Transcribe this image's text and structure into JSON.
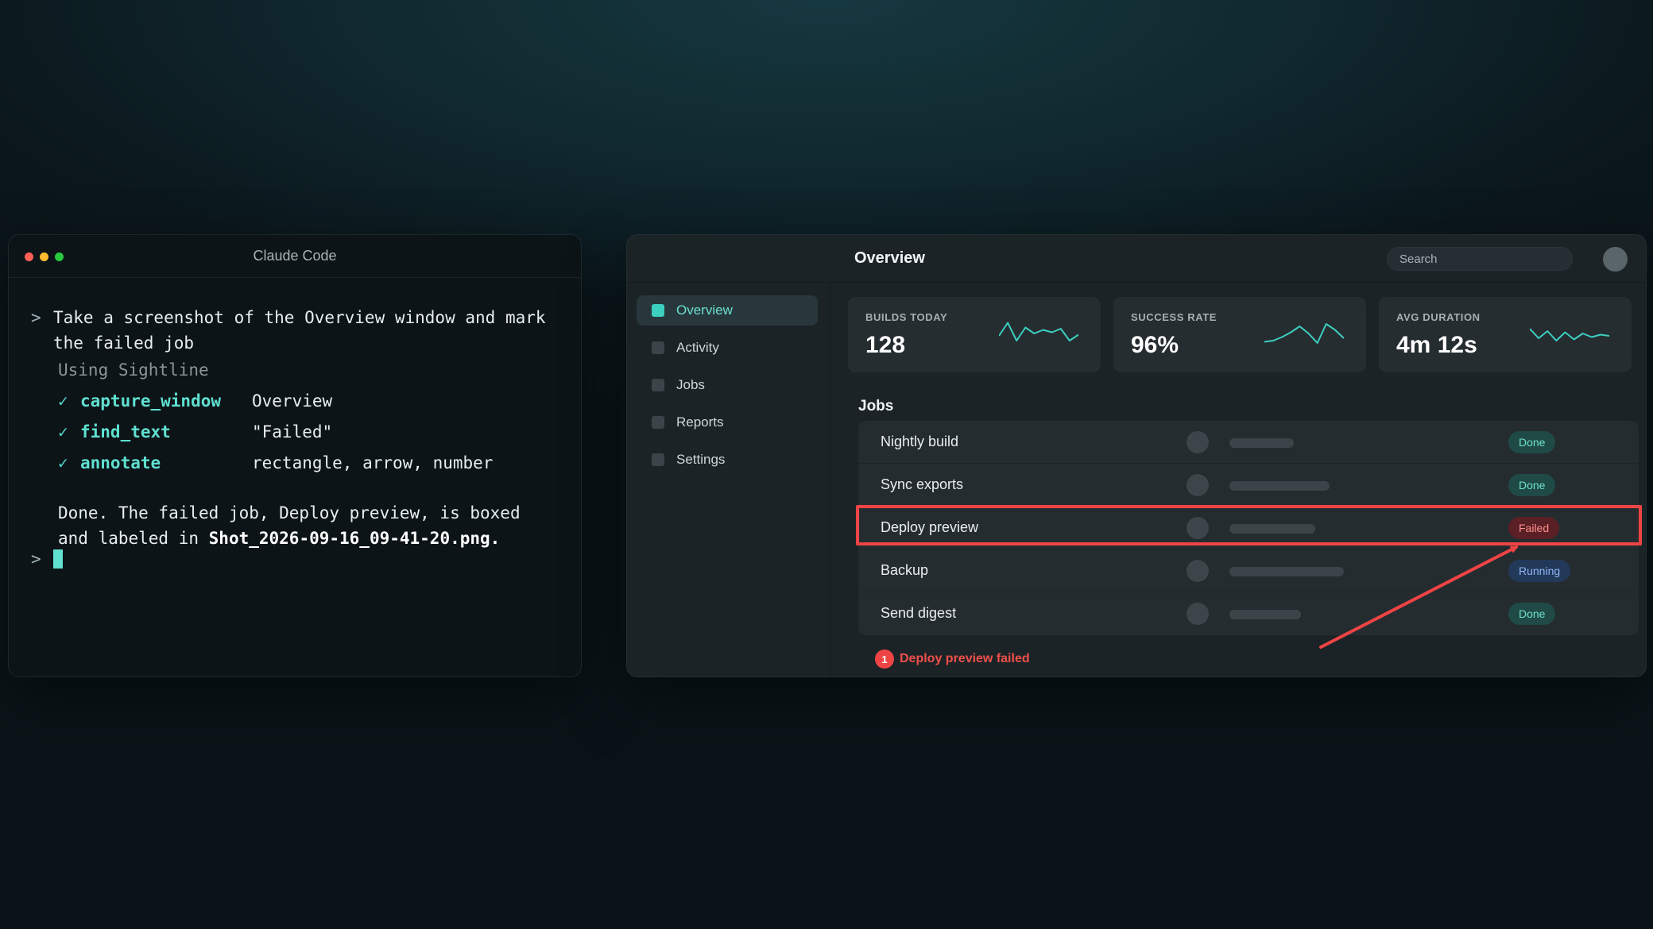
{
  "terminal": {
    "title": "Claude Code",
    "prompt_char": ">",
    "prompt_line1": "Take a screenshot of the Overview window and mark",
    "prompt_line2": "the failed job",
    "using": "Using Sightline",
    "check_glyph": "✓",
    "tools": [
      {
        "name": "capture_window",
        "arg": "Overview"
      },
      {
        "name": "find_text",
        "arg": "\"Failed\""
      },
      {
        "name": "annotate",
        "arg": "rectangle, arrow, number"
      }
    ],
    "result_line1": "Done. The failed job, Deploy preview, is boxed",
    "result_line2_prefix": "and labeled in ",
    "result_file": "Shot_2026-09-16_09-41-20.png",
    "result_suffix": "."
  },
  "app": {
    "title": "Overview",
    "search_placeholder": "Search",
    "nav": [
      {
        "label": "Overview",
        "active": true
      },
      {
        "label": "Activity",
        "active": false
      },
      {
        "label": "Jobs",
        "active": false
      },
      {
        "label": "Reports",
        "active": false
      },
      {
        "label": "Settings",
        "active": false
      }
    ],
    "stats": [
      {
        "label": "BUILDS TODAY",
        "value": "128",
        "trend": [
          0.4,
          0.95,
          0.2,
          0.75,
          0.5,
          0.65,
          0.55,
          0.7,
          0.2,
          0.45
        ]
      },
      {
        "label": "SUCCESS RATE",
        "value": "96%",
        "trend": [
          0.15,
          0.2,
          0.35,
          0.55,
          0.8,
          0.5,
          0.1,
          0.9,
          0.65,
          0.3
        ]
      },
      {
        "label": "AVG DURATION",
        "value": "4m 12s",
        "trend": [
          0.7,
          0.3,
          0.6,
          0.2,
          0.55,
          0.25,
          0.5,
          0.35,
          0.45,
          0.4
        ]
      }
    ],
    "jobs_heading": "Jobs",
    "jobs": [
      {
        "name": "Nightly build",
        "progress": 0.45,
        "status": "Done",
        "status_type": "done"
      },
      {
        "name": "Sync exports",
        "progress": 0.7,
        "status": "Done",
        "status_type": "done"
      },
      {
        "name": "Deploy preview",
        "progress": 0.6,
        "status": "Failed",
        "status_type": "failed"
      },
      {
        "name": "Backup",
        "progress": 0.8,
        "status": "Running",
        "status_type": "running"
      },
      {
        "name": "Send digest",
        "progress": 0.5,
        "status": "Done",
        "status_type": "done"
      }
    ],
    "error_number": "1",
    "error_text": "Deploy preview failed"
  },
  "colors": {
    "accent": "#3ccfc0",
    "annotation": "#ef4444",
    "sparkline": "#3ccfc0"
  }
}
